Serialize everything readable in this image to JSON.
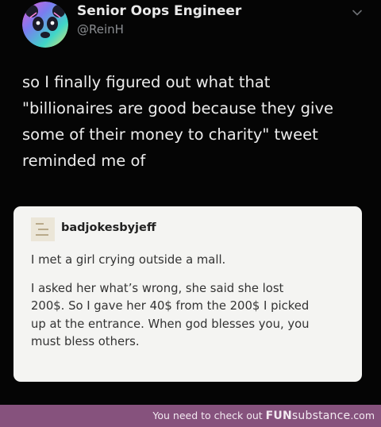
{
  "tweet": {
    "display_name": "Senior Oops Engineer",
    "handle": "@ReinH",
    "text_lines": [
      "so I finally figured out what that",
      "\"billionaires are good because they give",
      "some of their money to charity\" tweet",
      "reminded me of"
    ]
  },
  "embedded_post": {
    "blog_name": "badjokesbyjeff",
    "paragraph1_lines": [
      "I met a girl crying outside a mall."
    ],
    "paragraph2_lines": [
      "I asked her what’s wrong, she said she lost",
      "200$. So I gave her 40$ from the 200$ I picked",
      "up at the entrance. When god blesses you, you",
      "must bless others."
    ]
  },
  "footer": {
    "prefix": "You need to check out ",
    "brand_fun": "FUN",
    "brand_substance": "substance",
    "domain": ".com"
  },
  "colors": {
    "background": "#000000",
    "card_background": "#f4f4f2",
    "footer_background": "#86527d"
  },
  "icons": {
    "avatar": "rainbow-panda-avatar",
    "menu": "chevron-down-icon",
    "blog_avatar": "bad-jokes-blog-avatar"
  }
}
